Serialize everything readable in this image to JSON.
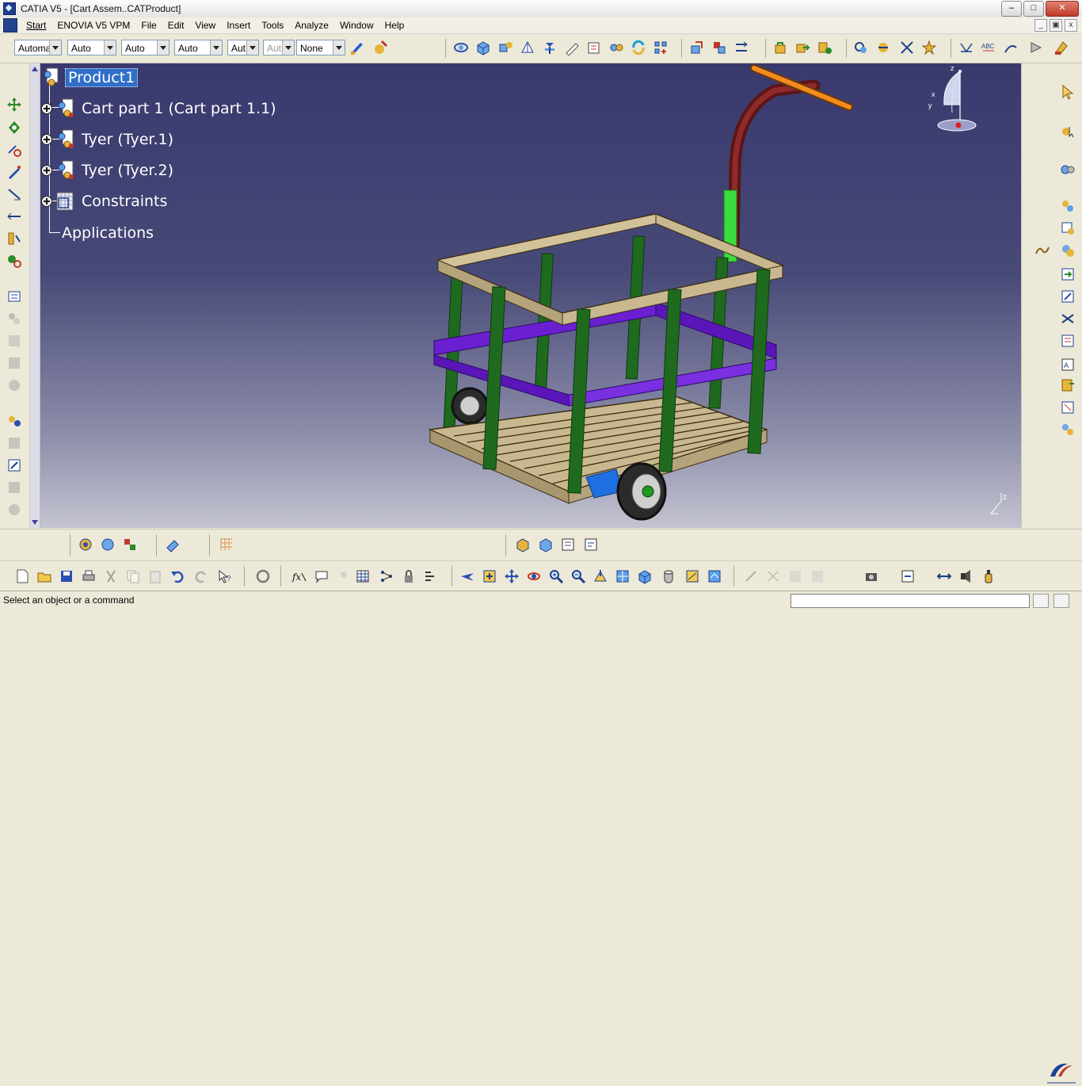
{
  "window": {
    "title": "CATIA V5 - [Cart Assem..CATProduct]",
    "min_label": "–",
    "max_label": "□",
    "close_label": "✕"
  },
  "menu": {
    "items": [
      "Start",
      "ENOVIA V5 VPM",
      "File",
      "Edit",
      "View",
      "Insert",
      "Tools",
      "Analyze",
      "Window",
      "Help"
    ],
    "mdi_min": "_",
    "mdi_restore": "▣",
    "mdi_close": "x"
  },
  "toolbar": {
    "combos": [
      {
        "value": "Automa",
        "disabled": false
      },
      {
        "value": "Auto",
        "disabled": false
      },
      {
        "value": "Auto",
        "disabled": false
      },
      {
        "value": "Auto",
        "disabled": false
      },
      {
        "value": "Aut",
        "disabled": false
      },
      {
        "value": "Aut",
        "disabled": true
      },
      {
        "value": "None",
        "disabled": false
      }
    ]
  },
  "tree": {
    "root": "Product1",
    "children": [
      "Cart part 1 (Cart part 1.1)",
      "Tyer (Tyer.1)",
      "Tyer (Tyer.2)",
      "Constraints"
    ],
    "applications": "Applications"
  },
  "compass": {
    "x_label": "x",
    "y_label": "y",
    "z_label": "z"
  },
  "axis_marker": {
    "z_label": "z"
  },
  "status": {
    "message": "Select an object or a command"
  },
  "colors": {
    "viewport_top": "#39396e",
    "viewport_bottom": "#c3c3d1",
    "selection": "#2f6fc8",
    "frame_wood": "#c9b88f",
    "post_green": "#1f6a1f",
    "rail_purple": "#6a1fd1",
    "handle_orange": "#f28c1e",
    "handle_red": "#7a1e1e",
    "grip_green": "#3ddb3d",
    "block_blue": "#1e6fe0"
  }
}
